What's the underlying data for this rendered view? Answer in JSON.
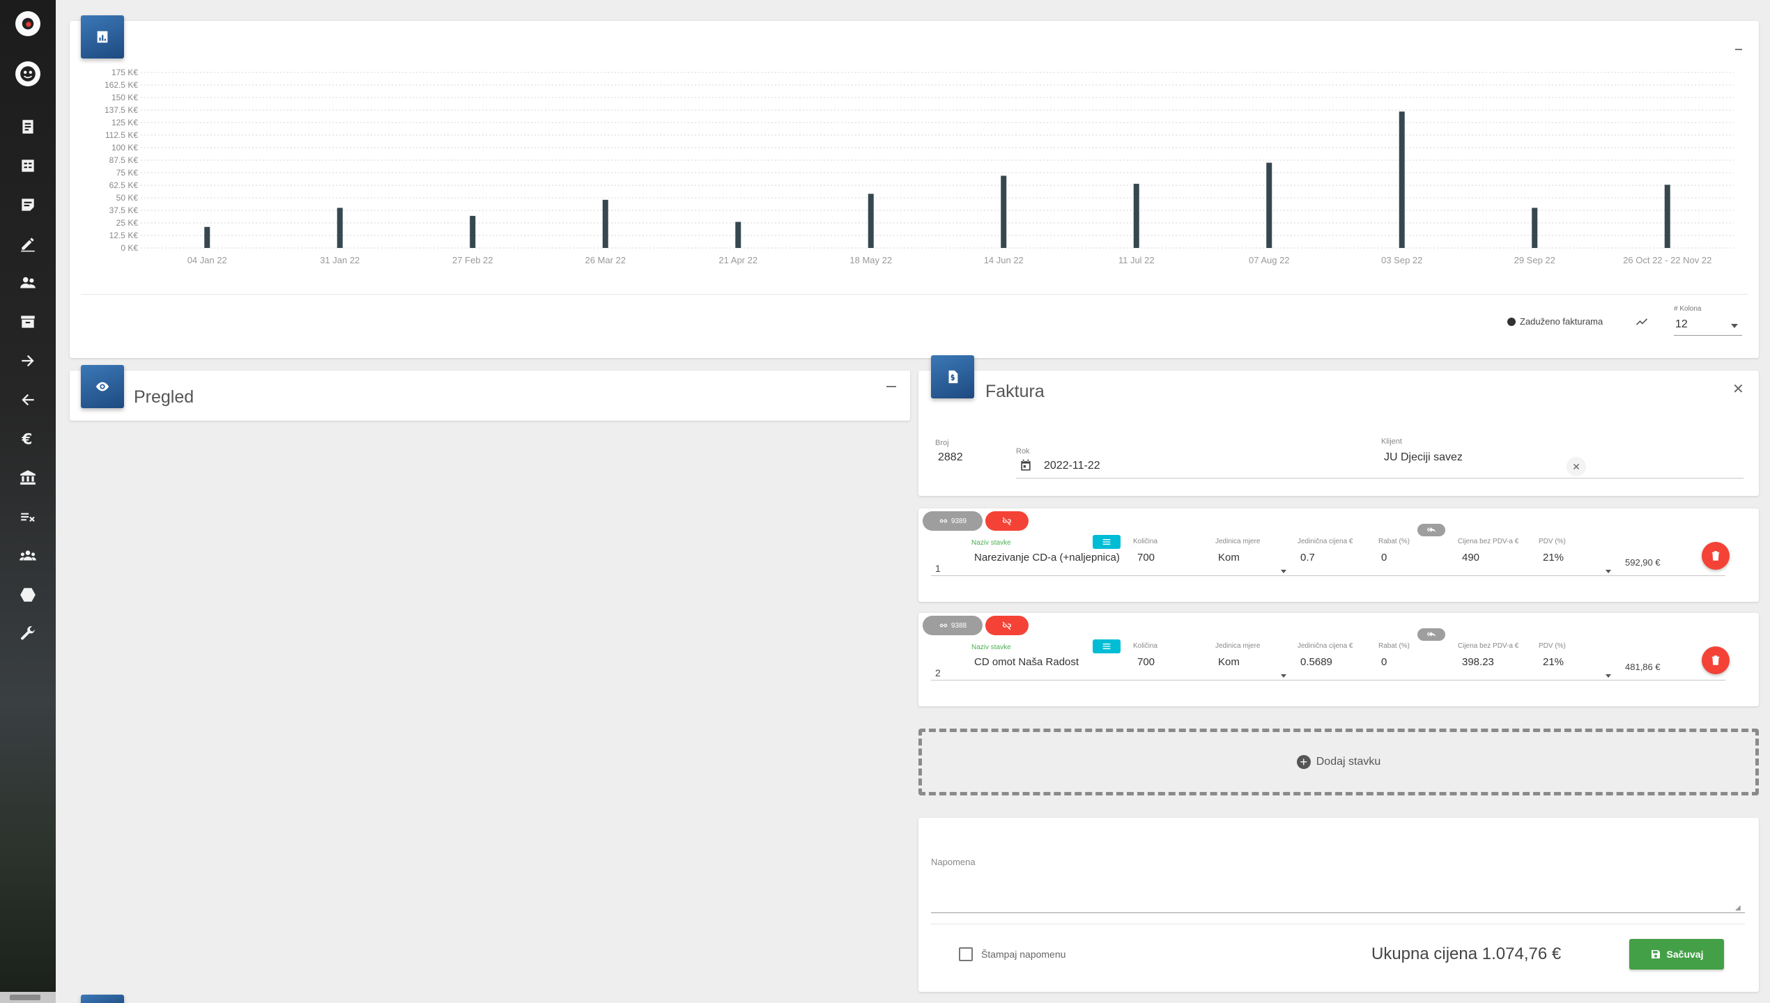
{
  "sidebar": {
    "items": [
      {
        "name": "home-icon"
      },
      {
        "name": "user-avatar-icon"
      },
      {
        "name": "invoices-icon"
      },
      {
        "name": "offers-icon"
      },
      {
        "name": "notes-icon"
      },
      {
        "name": "edit-icon"
      },
      {
        "name": "clients-icon"
      },
      {
        "name": "archive-icon"
      },
      {
        "name": "arrow-right-icon"
      },
      {
        "name": "arrow-left-icon"
      },
      {
        "name": "euro-icon"
      },
      {
        "name": "bank-icon"
      },
      {
        "name": "tax-icon"
      },
      {
        "name": "groups-icon"
      },
      {
        "name": "hexagon-icon"
      },
      {
        "name": "wrench-icon"
      }
    ]
  },
  "chart_data": {
    "type": "bar",
    "categories": [
      "04 Jan 22",
      "31 Jan 22",
      "27 Feb 22",
      "26 Mar 22",
      "21 Apr 22",
      "18 May 22",
      "14 Jun 22",
      "11 Jul 22",
      "07 Aug 22",
      "03 Sep 22",
      "29 Sep 22",
      "26 Oct 22 - 22 Nov 22"
    ],
    "series": [
      {
        "name": "Zaduženo fakturama",
        "values": [
          21000,
          40000,
          32000,
          48000,
          26000,
          54000,
          72000,
          64000,
          85000,
          136000,
          40000,
          63000
        ]
      }
    ],
    "yticks": [
      "0 K€",
      "12.5 K€",
      "25 K€",
      "37.5 K€",
      "50 K€",
      "62.5 K€",
      "75 K€",
      "87.5 K€",
      "100 K€",
      "112.5 K€",
      "125 K€",
      "137.5 K€",
      "150 K€",
      "162.5 K€",
      "175 K€"
    ],
    "ylim": [
      0,
      175000
    ],
    "grid": true,
    "color": "#37474f"
  },
  "chart_controls": {
    "legend_label": "Zaduženo fakturama",
    "columns_label": "# Kolona",
    "columns_value": "12"
  },
  "pregled": {
    "title": "Pregled"
  },
  "faktura": {
    "title": "Faktura",
    "broj_label": "Broj",
    "broj_value": "2882",
    "rok_label": "Rok",
    "rok_value": "2022-11-22",
    "klijent_label": "Klijent",
    "klijent_value": "JU Djeciji savez"
  },
  "item_headers": {
    "naziv": "Naziv stavke",
    "kolicina": "Količina",
    "jedinica": "Jedinica mjere",
    "jedinicna_cijena": "Jedinična cijena €",
    "rabat": "Rabat (%)",
    "cijena_bez_pdv": "Cijena bez PDV-a €",
    "pdv": "PDV (%)"
  },
  "items": [
    {
      "num": "1",
      "link_id": "9389",
      "naziv": "Narezivanje CD-a (+naljepnica)",
      "kolicina": "700",
      "jedinica": "Kom",
      "jedinicna_cijena": "0.7",
      "rabat": "0",
      "cijena_bez_pdv": "490",
      "pdv": "21%",
      "total": "592,90 €"
    },
    {
      "num": "2",
      "link_id": "9388",
      "naziv": "CD omot Naša Radost",
      "kolicina": "700",
      "jedinica": "Kom",
      "jedinicna_cijena": "0.5689",
      "rabat": "0",
      "cijena_bez_pdv": "398.23",
      "pdv": "21%",
      "total": "481,86 €"
    }
  ],
  "add_item": {
    "label": "Dodaj stavku"
  },
  "footer": {
    "napomena_label": "Napomena",
    "stampaj_label": "Štampaj napomenu",
    "ukupna_cijena": "Ukupna cijena 1.074,76 €",
    "save_label": "Sačuvaj"
  },
  "colors": {
    "accent_blue": "#2a5f9e",
    "danger": "#f44336",
    "success": "#43a047",
    "cyan": "#00bcd4",
    "label_green": "#4caf50"
  }
}
